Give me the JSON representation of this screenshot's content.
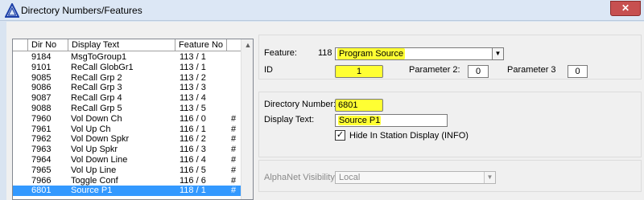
{
  "window": {
    "title": "Directory Numbers/Features",
    "close_label": "✕"
  },
  "list": {
    "headers": {
      "dir_no": "Dir No",
      "display_text": "Display Text",
      "feature_no": "Feature No"
    },
    "scroll_up": "▲",
    "rows": [
      {
        "dir": "9184",
        "text": "MsgToGroup1",
        "feat": "113  /  1",
        "flag": ""
      },
      {
        "dir": "9101",
        "text": "ReCall GlobGr1",
        "feat": "113  /  1",
        "flag": ""
      },
      {
        "dir": "9085",
        "text": "ReCall Grp 2",
        "feat": "113  /  2",
        "flag": ""
      },
      {
        "dir": "9086",
        "text": "ReCall Grp 3",
        "feat": "113  /  3",
        "flag": ""
      },
      {
        "dir": "9087",
        "text": "ReCall Grp 4",
        "feat": "113  /  4",
        "flag": ""
      },
      {
        "dir": "9088",
        "text": "ReCall Grp 5",
        "feat": "113  /  5",
        "flag": ""
      },
      {
        "dir": "7960",
        "text": "Vol Down Ch",
        "feat": "116  /  0",
        "flag": "#"
      },
      {
        "dir": "7961",
        "text": "Vol Up Ch",
        "feat": "116  /  1",
        "flag": "#"
      },
      {
        "dir": "7962",
        "text": "Vol Down Spkr",
        "feat": "116  /  2",
        "flag": "#"
      },
      {
        "dir": "7963",
        "text": "Vol Up Spkr",
        "feat": "116  /  3",
        "flag": "#"
      },
      {
        "dir": "7964",
        "text": "Vol Down Line",
        "feat": "116  /  4",
        "flag": "#"
      },
      {
        "dir": "7965",
        "text": "Vol Up Line",
        "feat": "116  /  5",
        "flag": "#"
      },
      {
        "dir": "7966",
        "text": "Toggle Conf",
        "feat": "116  /  6",
        "flag": "#"
      },
      {
        "dir": "6801",
        "text": "Source P1",
        "feat": "118  /  1",
        "flag": "#",
        "selected": true
      }
    ]
  },
  "feature": {
    "label": "Feature:",
    "number": "118",
    "value": "Program Source",
    "dropdown": "▼",
    "id_label": "ID",
    "id_value": "1",
    "param2_label": "Parameter 2:",
    "param2_value": "0",
    "param3_label": "Parameter 3",
    "param3_value": "0"
  },
  "directory": {
    "number_label": "Directory Number:",
    "number_value": "6801",
    "display_label": "Display Text:",
    "display_value": "Source P1",
    "hide_label": "Hide In Station Display (INFO)",
    "hide_checked": "✓"
  },
  "alphanet": {
    "label": "AlphaNet Visibility:",
    "value": "Local",
    "dropdown": "▼"
  },
  "colors": {
    "highlight": "#ffff33",
    "selection": "#3399ff"
  }
}
